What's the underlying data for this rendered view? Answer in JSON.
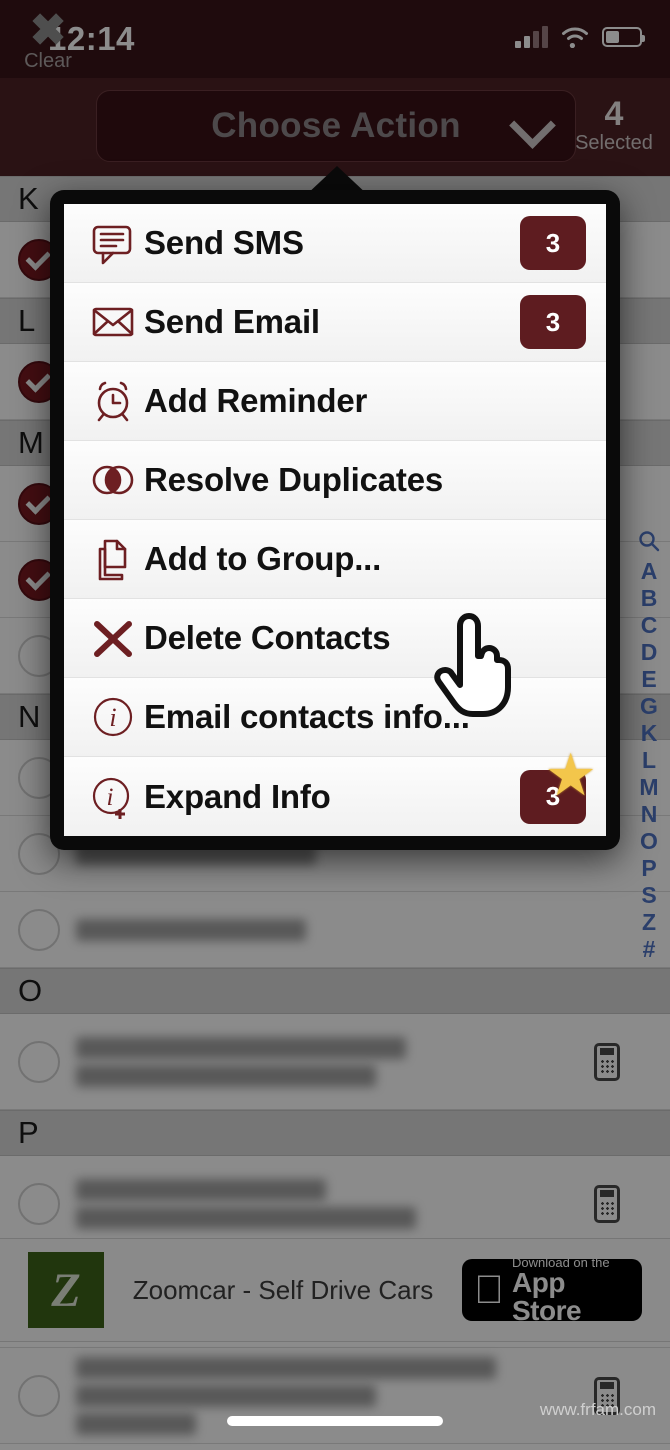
{
  "status_bar": {
    "time": "12:14",
    "signal_icon": "cellular-signal-icon",
    "wifi_icon": "wifi-icon",
    "battery_icon": "battery-icon",
    "battery_level_pct": 40,
    "signal_bars_filled": 2
  },
  "action_bar": {
    "clear_icon": "close-x-icon",
    "clear_label": "Clear",
    "dropdown_label": "Choose Action",
    "dropdown_chevron_icon": "chevron-down-icon",
    "selected_count": "4",
    "selected_label": "Selected",
    "bar_color": "#4d2226",
    "dropdown_color": "#3a1216"
  },
  "menu": {
    "accent_color": "#6d1f22",
    "badge_color": "#5e1c20",
    "items": [
      {
        "label": "Send SMS",
        "icon": "sms-bubble-icon",
        "badge": "3",
        "star": false
      },
      {
        "label": "Send Email",
        "icon": "envelope-icon",
        "badge": "3",
        "star": false
      },
      {
        "label": "Add Reminder",
        "icon": "alarm-clock-icon",
        "badge": null,
        "star": false
      },
      {
        "label": "Resolve Duplicates",
        "icon": "venn-circles-icon",
        "badge": null,
        "star": false
      },
      {
        "label": "Add to Group...",
        "icon": "copy-documents-icon",
        "badge": null,
        "star": false
      },
      {
        "label": "Delete Contacts",
        "icon": "x-cross-icon",
        "badge": null,
        "star": false
      },
      {
        "label": "Email contacts info...",
        "icon": "info-circle-icon",
        "badge": null,
        "star": false
      },
      {
        "label": "Expand Info",
        "icon": "info-plus-circle-icon",
        "badge": "3",
        "star": true
      }
    ]
  },
  "cursor": {
    "icon": "pointing-hand-cursor"
  },
  "contact_list": {
    "sections": [
      {
        "letter": "K",
        "rows": [
          {
            "checked": true,
            "has_phone": false,
            "name_redacted": true,
            "lines": 1
          }
        ]
      },
      {
        "letter": "L",
        "rows": [
          {
            "checked": true,
            "has_phone": false,
            "name_redacted": true,
            "lines": 1
          }
        ]
      },
      {
        "letter": "M",
        "rows": [
          {
            "checked": true,
            "has_phone": false,
            "name_redacted": true,
            "lines": 1
          },
          {
            "checked": true,
            "has_phone": false,
            "name_redacted": true,
            "lines": 1
          },
          {
            "checked": false,
            "has_phone": false,
            "name_redacted": true,
            "lines": 1
          }
        ]
      },
      {
        "letter": "N",
        "rows": [
          {
            "checked": false,
            "has_phone": false,
            "name_redacted": true,
            "lines": 1
          },
          {
            "checked": false,
            "has_phone": false,
            "name_redacted": true,
            "lines": 1
          },
          {
            "checked": false,
            "has_phone": false,
            "name_redacted": true,
            "lines": 1
          }
        ]
      },
      {
        "letter": "O",
        "rows": [
          {
            "checked": false,
            "has_phone": true,
            "name_redacted": true,
            "lines": 2
          }
        ]
      },
      {
        "letter": "P",
        "rows": [
          {
            "checked": false,
            "has_phone": true,
            "name_redacted": true,
            "lines": 2
          },
          {
            "checked": false,
            "has_phone": true,
            "name_redacted": true,
            "lines": 2
          },
          {
            "checked": false,
            "has_phone": true,
            "name_redacted": true,
            "lines": 3
          }
        ]
      }
    ]
  },
  "alphabet_index": {
    "search_icon": "search-icon",
    "letters": [
      "A",
      "B",
      "C",
      "D",
      "E",
      "G",
      "K",
      "L",
      "M",
      "N",
      "O",
      "P",
      "S",
      "Z",
      "#"
    ],
    "color": "#2b3f6b"
  },
  "ad_banner": {
    "logo_letter": "Z",
    "logo_color": "#3c6318",
    "text": "Zoomcar - Self Drive Cars",
    "store_icon": "apple-logo-icon",
    "store_line1": "Download on the",
    "store_line2": "App Store"
  },
  "footer": {
    "watermark": "www.frfam.com",
    "home_indicator": "home-indicator"
  }
}
